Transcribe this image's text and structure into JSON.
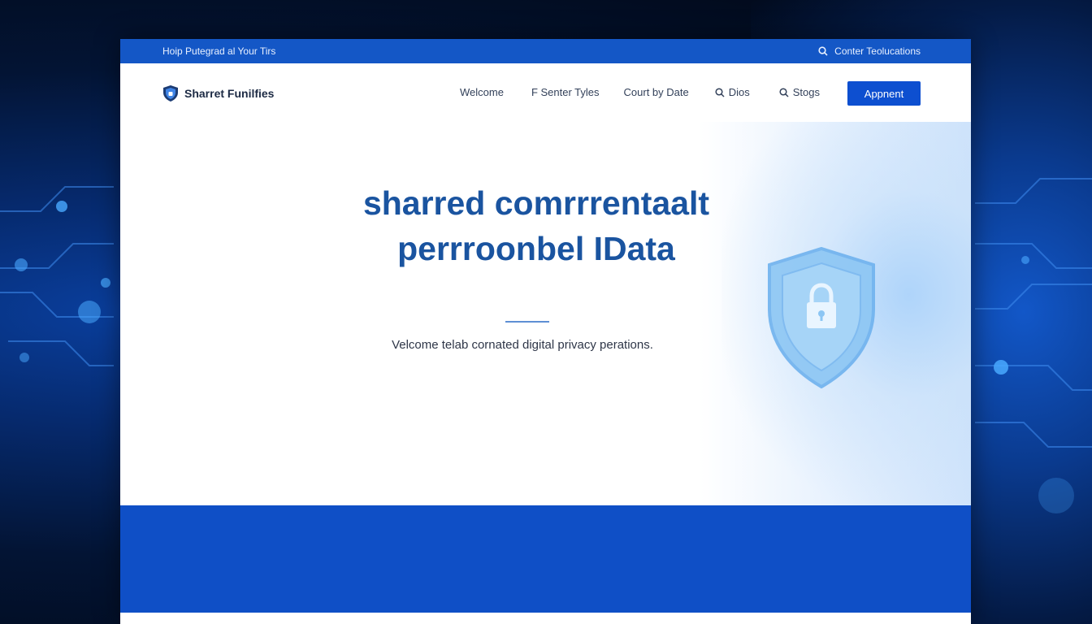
{
  "topbar": {
    "tagline": "Hoip Putegrad al Your Tirs",
    "contact_label": "Conter Teolucations"
  },
  "brand": {
    "name": "Sharret Funilfies"
  },
  "nav": {
    "items": [
      {
        "label": "Welcome",
        "icon": ""
      },
      {
        "label": "F Senter Tyles",
        "icon": ""
      },
      {
        "label": "Court by Date",
        "icon": ""
      },
      {
        "label": "Dios",
        "icon": "search-icon"
      },
      {
        "label": "Stogs",
        "icon": "search-icon"
      }
    ],
    "cta_label": "Appnent"
  },
  "hero": {
    "title_line1": "sharred comrrrentaalt",
    "title_line2": "perrroonbel IData",
    "subtitle": "Velcome telab cornated digital privacy perations."
  },
  "colors": {
    "brand_blue": "#1457c6",
    "cta_blue": "#0d4fd0",
    "title_blue": "#1a54a0",
    "band_blue": "#0f4fc6"
  }
}
